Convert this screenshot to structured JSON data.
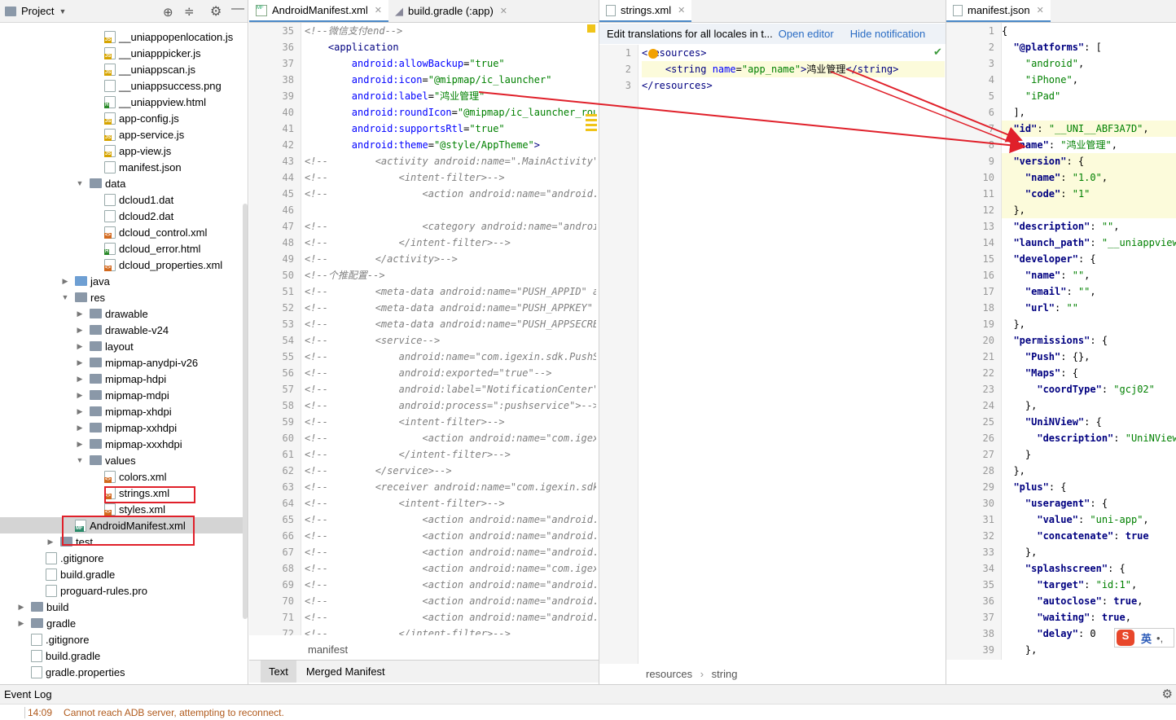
{
  "project": {
    "title": "Project",
    "tree": [
      {
        "label": "__uniappopenlocation.js",
        "kind": "js",
        "depth": 128,
        "arrow": ""
      },
      {
        "label": "__uniapppicker.js",
        "kind": "js",
        "depth": 128,
        "arrow": ""
      },
      {
        "label": "__uniappscan.js",
        "kind": "js",
        "depth": 128,
        "arrow": ""
      },
      {
        "label": "__uniappsuccess.png",
        "kind": "png",
        "depth": 128,
        "arrow": ""
      },
      {
        "label": "__uniappview.html",
        "kind": "html",
        "depth": 128,
        "arrow": ""
      },
      {
        "label": "app-config.js",
        "kind": "js",
        "depth": 128,
        "arrow": ""
      },
      {
        "label": "app-service.js",
        "kind": "js",
        "depth": 128,
        "arrow": ""
      },
      {
        "label": "app-view.js",
        "kind": "js",
        "depth": 128,
        "arrow": ""
      },
      {
        "label": "manifest.json",
        "kind": "json",
        "depth": 128,
        "arrow": ""
      },
      {
        "label": "data",
        "kind": "folder",
        "depth": 110,
        "arrow": "▼"
      },
      {
        "label": "dcloud1.dat",
        "kind": "dat",
        "depth": 128,
        "arrow": ""
      },
      {
        "label": "dcloud2.dat",
        "kind": "dat",
        "depth": 128,
        "arrow": ""
      },
      {
        "label": "dcloud_control.xml",
        "kind": "xml",
        "depth": 128,
        "arrow": ""
      },
      {
        "label": "dcloud_error.html",
        "kind": "html",
        "depth": 128,
        "arrow": ""
      },
      {
        "label": "dcloud_properties.xml",
        "kind": "xml",
        "depth": 128,
        "arrow": ""
      },
      {
        "label": "java",
        "kind": "folderblue",
        "depth": 92,
        "arrow": "▶"
      },
      {
        "label": "res",
        "kind": "folder",
        "depth": 92,
        "arrow": "▼"
      },
      {
        "label": "drawable",
        "kind": "folder",
        "depth": 110,
        "arrow": "▶"
      },
      {
        "label": "drawable-v24",
        "kind": "folder",
        "depth": 110,
        "arrow": "▶"
      },
      {
        "label": "layout",
        "kind": "folder",
        "depth": 110,
        "arrow": "▶"
      },
      {
        "label": "mipmap-anydpi-v26",
        "kind": "folder",
        "depth": 110,
        "arrow": "▶"
      },
      {
        "label": "mipmap-hdpi",
        "kind": "folder",
        "depth": 110,
        "arrow": "▶"
      },
      {
        "label": "mipmap-mdpi",
        "kind": "folder",
        "depth": 110,
        "arrow": "▶"
      },
      {
        "label": "mipmap-xhdpi",
        "kind": "folder",
        "depth": 110,
        "arrow": "▶"
      },
      {
        "label": "mipmap-xxhdpi",
        "kind": "folder",
        "depth": 110,
        "arrow": "▶"
      },
      {
        "label": "mipmap-xxxhdpi",
        "kind": "folder",
        "depth": 110,
        "arrow": "▶"
      },
      {
        "label": "values",
        "kind": "folder",
        "depth": 110,
        "arrow": "▼"
      },
      {
        "label": "colors.xml",
        "kind": "xml",
        "depth": 128,
        "arrow": ""
      },
      {
        "label": "strings.xml",
        "kind": "xml",
        "depth": 128,
        "arrow": ""
      },
      {
        "label": "styles.xml",
        "kind": "xml",
        "depth": 128,
        "arrow": ""
      },
      {
        "label": "AndroidManifest.xml",
        "kind": "mf",
        "depth": 92,
        "arrow": "",
        "selected": true
      },
      {
        "label": "test",
        "kind": "folder",
        "depth": 74,
        "arrow": "▶"
      },
      {
        "label": ".gitignore",
        "kind": "txt",
        "depth": 56,
        "arrow": ""
      },
      {
        "label": "build.gradle",
        "kind": "gradle",
        "depth": 56,
        "arrow": ""
      },
      {
        "label": "proguard-rules.pro",
        "kind": "txt",
        "depth": 56,
        "arrow": ""
      },
      {
        "label": "build",
        "kind": "folder",
        "depth": 38,
        "arrow": "▶"
      },
      {
        "label": "gradle",
        "kind": "folder",
        "depth": 38,
        "arrow": "▶"
      },
      {
        "label": ".gitignore",
        "kind": "txt",
        "depth": 38,
        "arrow": ""
      },
      {
        "label": "build.gradle",
        "kind": "gradle",
        "depth": 38,
        "arrow": ""
      },
      {
        "label": "gradle.properties",
        "kind": "props",
        "depth": 38,
        "arrow": ""
      }
    ]
  },
  "manifest_editor": {
    "tabs": [
      "AndroidManifest.xml",
      "build.gradle (:app)"
    ],
    "first_line": 35,
    "lines": [
      [
        [
          "cm",
          "<!--微信支付end-->"
        ]
      ],
      [
        [
          "",
          "    "
        ],
        [
          "tg",
          "<application"
        ]
      ],
      [
        [
          "",
          "        "
        ],
        [
          "at",
          "android:allowBackup"
        ],
        [
          "",
          "="
        ],
        [
          "sv",
          "\"true\""
        ]
      ],
      [
        [
          "",
          "        "
        ],
        [
          "at",
          "android:icon"
        ],
        [
          "",
          "="
        ],
        [
          "sv",
          "\"@mipmap/ic_launcher\""
        ]
      ],
      [
        [
          "",
          "        "
        ],
        [
          "at",
          "android:label"
        ],
        [
          "",
          "="
        ],
        [
          "sv",
          "\"鸿业管理\""
        ]
      ],
      [
        [
          "",
          "        "
        ],
        [
          "at",
          "android:roundIcon"
        ],
        [
          "",
          "="
        ],
        [
          "sv",
          "\"@mipmap/ic_launcher_round\""
        ]
      ],
      [
        [
          "",
          "        "
        ],
        [
          "at",
          "android:supportsRtl"
        ],
        [
          "",
          "="
        ],
        [
          "sv",
          "\"true\""
        ]
      ],
      [
        [
          "",
          "        "
        ],
        [
          "at",
          "android:theme"
        ],
        [
          "",
          "="
        ],
        [
          "sv",
          "\"@style/AppTheme\""
        ],
        [
          "tg",
          ">"
        ]
      ],
      [
        [
          "cm",
          "<!--        <activity android:name=\".MainActivity\">"
        ]
      ],
      [
        [
          "cm",
          "<!--            <intent-filter>-->"
        ]
      ],
      [
        [
          "cm",
          "<!--                <action android:name=\"android.intent"
        ]
      ],
      [
        [
          "",
          ""
        ]
      ],
      [
        [
          "cm",
          "<!--                <category android:name=\"android.intent"
        ]
      ],
      [
        [
          "cm",
          "<!--            </intent-filter>-->"
        ]
      ],
      [
        [
          "cm",
          "<!--        </activity>-->"
        ]
      ],
      [
        [
          "cm",
          "<!--个推配置-->"
        ]
      ],
      [
        [
          "cm",
          "<!--        <meta-data android:name=\"PUSH_APPID\" android"
        ]
      ],
      [
        [
          "cm",
          "<!--        <meta-data android:name=\"PUSH_APPKEY\" andr"
        ]
      ],
      [
        [
          "cm",
          "<!--        <meta-data android:name=\"PUSH_APPSECRET\" a"
        ]
      ],
      [
        [
          "cm",
          "<!--        <service-->"
        ]
      ],
      [
        [
          "cm",
          "<!--            android:name=\"com.igexin.sdk.PushService"
        ]
      ],
      [
        [
          "cm",
          "<!--            android:exported=\"true\"-->"
        ]
      ],
      [
        [
          "cm",
          "<!--            android:label=\"NotificationCenter\"-->"
        ]
      ],
      [
        [
          "cm",
          "<!--            android:process=\":pushservice\">-->"
        ]
      ],
      [
        [
          "cm",
          "<!--            <intent-filter>-->"
        ]
      ],
      [
        [
          "cm",
          "<!--                <action android:name=\"com.igexin.sdk"
        ]
      ],
      [
        [
          "cm",
          "<!--            </intent-filter>-->"
        ]
      ],
      [
        [
          "cm",
          "<!--        </service>-->"
        ]
      ],
      [
        [
          "cm",
          "<!--        <receiver android:name=\"com.igexin.sdk.PushR"
        ]
      ],
      [
        [
          "cm",
          "<!--            <intent-filter>-->"
        ]
      ],
      [
        [
          "cm",
          "<!--                <action android:name=\"android.intent"
        ]
      ],
      [
        [
          "cm",
          "<!--                <action android:name=\"android.net.c"
        ]
      ],
      [
        [
          "cm",
          "<!--                <action android:name=\"android.intent"
        ]
      ],
      [
        [
          "cm",
          "<!--                <action android:name=\"com.igexin.sd"
        ]
      ],
      [
        [
          "cm",
          "<!--                <action android:name=\"android.intent"
        ]
      ],
      [
        [
          "cm",
          "<!--                <action android:name=\"android.intent"
        ]
      ],
      [
        [
          "cm",
          "<!--                <action android:name=\"android.intent"
        ]
      ],
      [
        [
          "cm",
          "<!--            </intent-filter>-->"
        ]
      ]
    ],
    "breadcrumb": "manifest",
    "bottom_tabs": [
      "Text",
      "Merged Manifest"
    ]
  },
  "strings_editor": {
    "tab": "strings.xml",
    "notice": "Edit translations for all locales in t...",
    "open_editor": "Open editor",
    "hide_notification": "Hide notification",
    "lines": [
      [
        [
          "tg",
          "<resources>"
        ]
      ],
      [
        [
          "",
          "    "
        ],
        [
          "tg",
          "<string "
        ],
        [
          "at",
          "name"
        ],
        [
          "",
          "="
        ],
        [
          "sv",
          "\"app_name\""
        ],
        [
          "tg",
          ">"
        ],
        [
          "",
          "鸿业管理"
        ],
        [
          "tg",
          "</string>"
        ]
      ],
      [
        [
          "tg",
          "</resources>"
        ]
      ]
    ],
    "breadcrumb": [
      "resources",
      "string"
    ]
  },
  "json_editor": {
    "tab": "manifest.json",
    "lines": [
      [
        [
          "",
          "{"
        ]
      ],
      [
        [
          "",
          "  "
        ],
        [
          "kw",
          "\"@platforms\""
        ],
        [
          "",
          ": ["
        ]
      ],
      [
        [
          "",
          "    "
        ],
        [
          "sv",
          "\"android\""
        ],
        [
          "",
          ","
        ]
      ],
      [
        [
          "",
          "    "
        ],
        [
          "sv",
          "\"iPhone\""
        ],
        [
          "",
          ","
        ]
      ],
      [
        [
          "",
          "    "
        ],
        [
          "sv",
          "\"iPad\""
        ]
      ],
      [
        [
          "",
          "  ],"
        ]
      ],
      [
        [
          "",
          "  "
        ],
        [
          "kw",
          "\"id\""
        ],
        [
          "",
          ": "
        ],
        [
          "sv",
          "\"__UNI__ABF3A7D\""
        ],
        [
          "",
          ","
        ]
      ],
      [
        [
          "",
          "  "
        ],
        [
          "kw",
          "\"name\""
        ],
        [
          "",
          ": "
        ],
        [
          "sv",
          "\"鸿业管理\""
        ],
        [
          "",
          ","
        ]
      ],
      [
        [
          "",
          "  "
        ],
        [
          "kw",
          "\"version\""
        ],
        [
          "",
          ": {"
        ]
      ],
      [
        [
          "",
          "    "
        ],
        [
          "kw",
          "\"name\""
        ],
        [
          "",
          ": "
        ],
        [
          "sv",
          "\"1.0\""
        ],
        [
          "",
          ","
        ]
      ],
      [
        [
          "",
          "    "
        ],
        [
          "kw",
          "\"code\""
        ],
        [
          "",
          ": "
        ],
        [
          "sv",
          "\"1\""
        ]
      ],
      [
        [
          "",
          "  },"
        ]
      ],
      [
        [
          "",
          "  "
        ],
        [
          "kw",
          "\"description\""
        ],
        [
          "",
          ": "
        ],
        [
          "sv",
          "\"\""
        ],
        [
          "",
          ","
        ]
      ],
      [
        [
          "",
          "  "
        ],
        [
          "kw",
          "\"launch_path\""
        ],
        [
          "",
          ": "
        ],
        [
          "sv",
          "\"__uniappview.html\""
        ]
      ],
      [
        [
          "",
          "  "
        ],
        [
          "kw",
          "\"developer\""
        ],
        [
          "",
          ": {"
        ]
      ],
      [
        [
          "",
          "    "
        ],
        [
          "kw",
          "\"name\""
        ],
        [
          "",
          ": "
        ],
        [
          "sv",
          "\"\""
        ],
        [
          "",
          ","
        ]
      ],
      [
        [
          "",
          "    "
        ],
        [
          "kw",
          "\"email\""
        ],
        [
          "",
          ": "
        ],
        [
          "sv",
          "\"\""
        ],
        [
          "",
          ","
        ]
      ],
      [
        [
          "",
          "    "
        ],
        [
          "kw",
          "\"url\""
        ],
        [
          "",
          ": "
        ],
        [
          "sv",
          "\"\""
        ]
      ],
      [
        [
          "",
          "  },"
        ]
      ],
      [
        [
          "",
          "  "
        ],
        [
          "kw",
          "\"permissions\""
        ],
        [
          "",
          ": {"
        ]
      ],
      [
        [
          "",
          "    "
        ],
        [
          "kw",
          "\"Push\""
        ],
        [
          "",
          ": {},"
        ]
      ],
      [
        [
          "",
          "    "
        ],
        [
          "kw",
          "\"Maps\""
        ],
        [
          "",
          ": {"
        ]
      ],
      [
        [
          "",
          "      "
        ],
        [
          "kw",
          "\"coordType\""
        ],
        [
          "",
          ": "
        ],
        [
          "sv",
          "\"gcj02\""
        ]
      ],
      [
        [
          "",
          "    },"
        ]
      ],
      [
        [
          "",
          "    "
        ],
        [
          "kw",
          "\"UniNView\""
        ],
        [
          "",
          ": {"
        ]
      ],
      [
        [
          "",
          "      "
        ],
        [
          "kw",
          "\"description\""
        ],
        [
          "",
          ": "
        ],
        [
          "sv",
          "\"UniNView原生渲染\""
        ]
      ],
      [
        [
          "",
          "    }"
        ]
      ],
      [
        [
          "",
          "  },"
        ]
      ],
      [
        [
          "",
          "  "
        ],
        [
          "kw",
          "\"plus\""
        ],
        [
          "",
          ": {"
        ]
      ],
      [
        [
          "",
          "    "
        ],
        [
          "kw",
          "\"useragent\""
        ],
        [
          "",
          ": {"
        ]
      ],
      [
        [
          "",
          "      "
        ],
        [
          "kw",
          "\"value\""
        ],
        [
          "",
          ": "
        ],
        [
          "sv",
          "\"uni-app\""
        ],
        [
          "",
          ","
        ]
      ],
      [
        [
          "",
          "      "
        ],
        [
          "kw",
          "\"concatenate\""
        ],
        [
          "",
          ": "
        ],
        [
          "kw",
          "true"
        ]
      ],
      [
        [
          "",
          "    },"
        ]
      ],
      [
        [
          "",
          "    "
        ],
        [
          "kw",
          "\"splashscreen\""
        ],
        [
          "",
          ": {"
        ]
      ],
      [
        [
          "",
          "      "
        ],
        [
          "kw",
          "\"target\""
        ],
        [
          "",
          ": "
        ],
        [
          "sv",
          "\"id:1\""
        ],
        [
          "",
          ","
        ]
      ],
      [
        [
          "",
          "      "
        ],
        [
          "kw",
          "\"autoclose\""
        ],
        [
          "",
          ": "
        ],
        [
          "kw",
          "true"
        ],
        [
          "",
          ","
        ]
      ],
      [
        [
          "",
          "      "
        ],
        [
          "kw",
          "\"waiting\""
        ],
        [
          "",
          ": "
        ],
        [
          "kw",
          "true"
        ],
        [
          "",
          ","
        ]
      ],
      [
        [
          "",
          "      "
        ],
        [
          "kw",
          "\"delay\""
        ],
        [
          "",
          ": 0"
        ]
      ],
      [
        [
          "",
          "    },"
        ]
      ]
    ]
  },
  "ime": {
    "label": "英",
    "extra": "•,"
  },
  "event_log": {
    "title": "Event Log",
    "time": "14:09",
    "message": "Cannot reach ADB server, attempting to reconnect."
  },
  "colors": {
    "accent": "#4a88c7",
    "annotation": "#e0202a"
  }
}
